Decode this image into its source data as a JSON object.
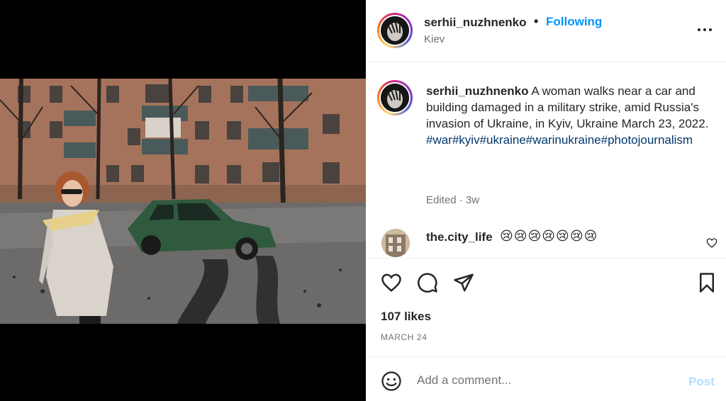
{
  "post": {
    "username": "serhii_nuzhnenko",
    "separator": "•",
    "follow_status": "Following",
    "location": "Kiev",
    "caption_text": "A woman walks near a car and building damaged in a military strike, amid Russia's invasion of Ukraine, in Kyiv, Ukraine March 23, 2022.",
    "caption_tags": "#war#kyiv#ukraine#warinukraine#photojournalism",
    "caption_meta": "Edited · 3w",
    "likes": "107 likes",
    "date": "MARCH 24"
  },
  "comment": {
    "username": "the.city_life",
    "text": "😢😢😢😢😢😢😢"
  },
  "add_comment": {
    "placeholder": "Add a comment...",
    "post_label": "Post"
  },
  "icons": {
    "more": "more-options-icon",
    "like": "heart-icon",
    "comment": "comment-icon",
    "share": "share-icon",
    "save": "bookmark-icon",
    "emoji": "emoji-icon"
  },
  "colors": {
    "link": "#0095f6",
    "hashtag": "#00376b",
    "muted": "#737373",
    "post_disabled": "#b2dffc"
  }
}
